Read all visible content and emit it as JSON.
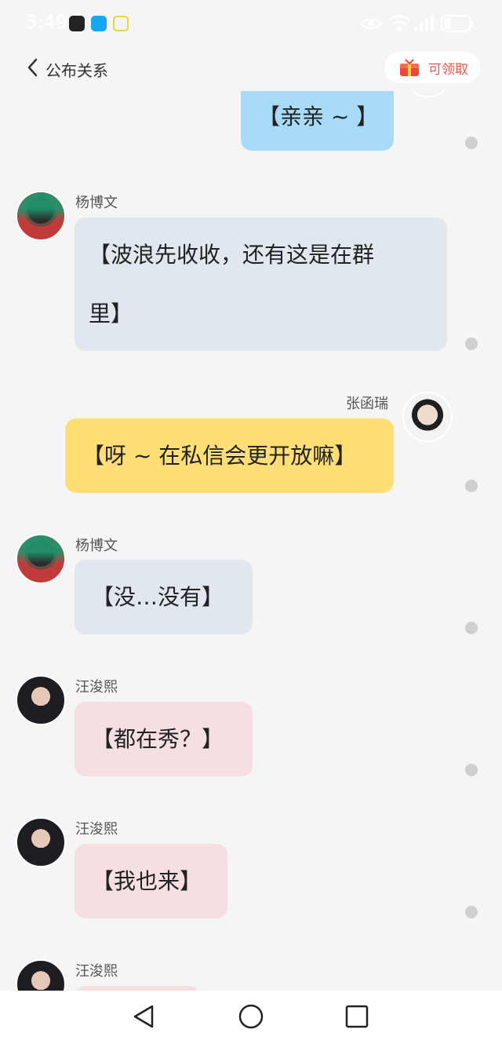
{
  "status_bar": {
    "time": "3:49",
    "app_icons": [
      "chat-app-icon",
      "search-app-icon",
      "tulip-app-icon"
    ],
    "right_icons": [
      "eye-icon",
      "wifi-icon",
      "signal-icon",
      "battery-icon"
    ]
  },
  "header": {
    "back_icon": "chevron-left-icon",
    "title": "公布关系",
    "reward_button": {
      "icon": "red-envelope-icon",
      "label": "可领取",
      "color": "#e8584a"
    }
  },
  "messages": [
    {
      "side": "right",
      "sender": "",
      "text": "【亲亲 ~ 】",
      "color": "#a8dbf8",
      "avatar": "partial-avatar"
    },
    {
      "side": "left",
      "sender": "杨博文",
      "lines": [
        "【波浪先收收，还有这是在群",
        "里】"
      ],
      "color": "#e1e7ef",
      "avatar": "yang-bowen-avatar"
    },
    {
      "side": "right",
      "sender": "张函瑞",
      "text": "【呀 ~ 在私信会更开放嘛】",
      "color": "#ffdf75",
      "avatar": "zhang-hanrui-avatar"
    },
    {
      "side": "left",
      "sender": "杨博文",
      "text": "【没…没有】",
      "color": "#e1e7ef",
      "avatar": "yang-bowen-avatar"
    },
    {
      "side": "left",
      "sender": "汪浚熙",
      "text": "【都在秀？】",
      "color": "#f5dfe2",
      "avatar": "wang-junxi-avatar"
    },
    {
      "side": "left",
      "sender": "汪浚熙",
      "text": "【我也来】",
      "color": "#f5dfe2",
      "avatar": "wang-junxi-avatar"
    },
    {
      "side": "left",
      "sender": "汪浚熙",
      "text": "",
      "color": "#f5dfe2",
      "avatar": "wang-junxi-avatar"
    }
  ],
  "nav_bar": {
    "buttons": [
      "back-triangle-icon",
      "home-circle-icon",
      "recents-square-icon"
    ]
  }
}
